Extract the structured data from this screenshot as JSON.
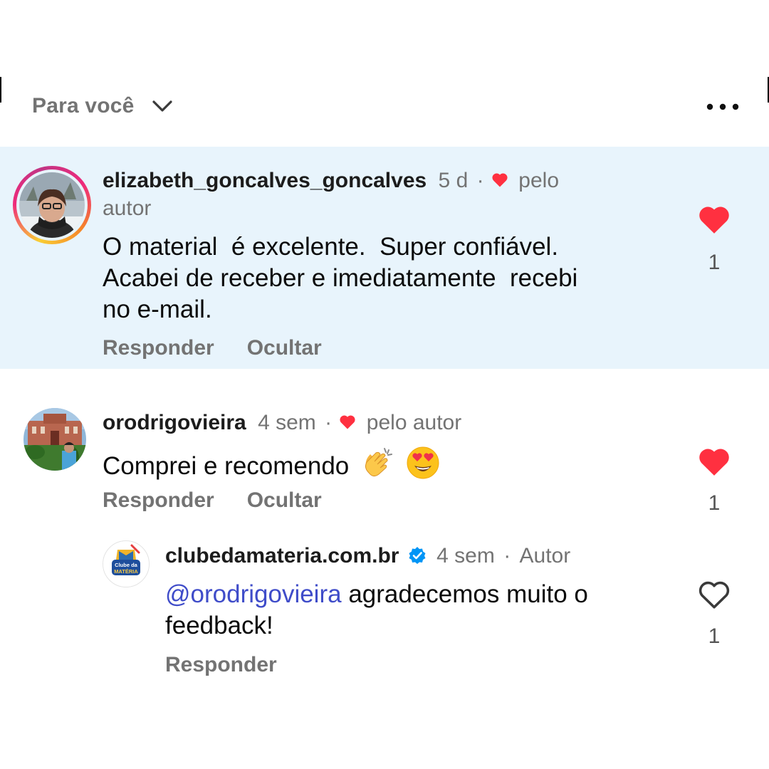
{
  "header": {
    "sort_label": "Para você",
    "sort_icon": "chevron-down-icon",
    "more_icon": "more-options-icon"
  },
  "comments": [
    {
      "username": "elizabeth_goncalves_goncalves",
      "time": "5 d",
      "separator": "·",
      "liked_by_author_text": "pelo",
      "liked_by_author_text_2": "autor",
      "text_line1": "O material  é excelente.  Super confiável.",
      "text_line2": "Acabei de receber e imediatamente  recebi",
      "text_line3": "no e-mail.",
      "reply_label": "Responder",
      "hide_label": "Ocultar",
      "like_count": "1",
      "liked": true,
      "has_story_ring": true
    },
    {
      "username": "orodrigovieira",
      "time": "4 sem",
      "separator": "·",
      "liked_by_author_text": "pelo autor",
      "text": "Comprei e recomendo",
      "emojis": [
        "clapping-hands-emoji",
        "heart-eyes-emoji"
      ],
      "reply_label": "Responder",
      "hide_label": "Ocultar",
      "like_count": "1",
      "liked": true
    }
  ],
  "reply": {
    "username": "clubedamateria.com.br",
    "verified": true,
    "time": "4 sem",
    "separator": "·",
    "author_label": "Autor",
    "mention": "@orodrigovieira",
    "text_line1": " agradecemos muito o",
    "text_line2": "feedback!",
    "reply_label": "Responder",
    "like_count": "1",
    "liked": false,
    "avatar_logo_line1": "Clube da",
    "avatar_logo_line2": "MATÉRIA"
  },
  "colors": {
    "like_red": "#ff3040",
    "highlight_bg": "#e8f4fc",
    "secondary_text": "#737373",
    "mention_blue": "#3f4cc9",
    "verified_blue": "#0095f6"
  }
}
